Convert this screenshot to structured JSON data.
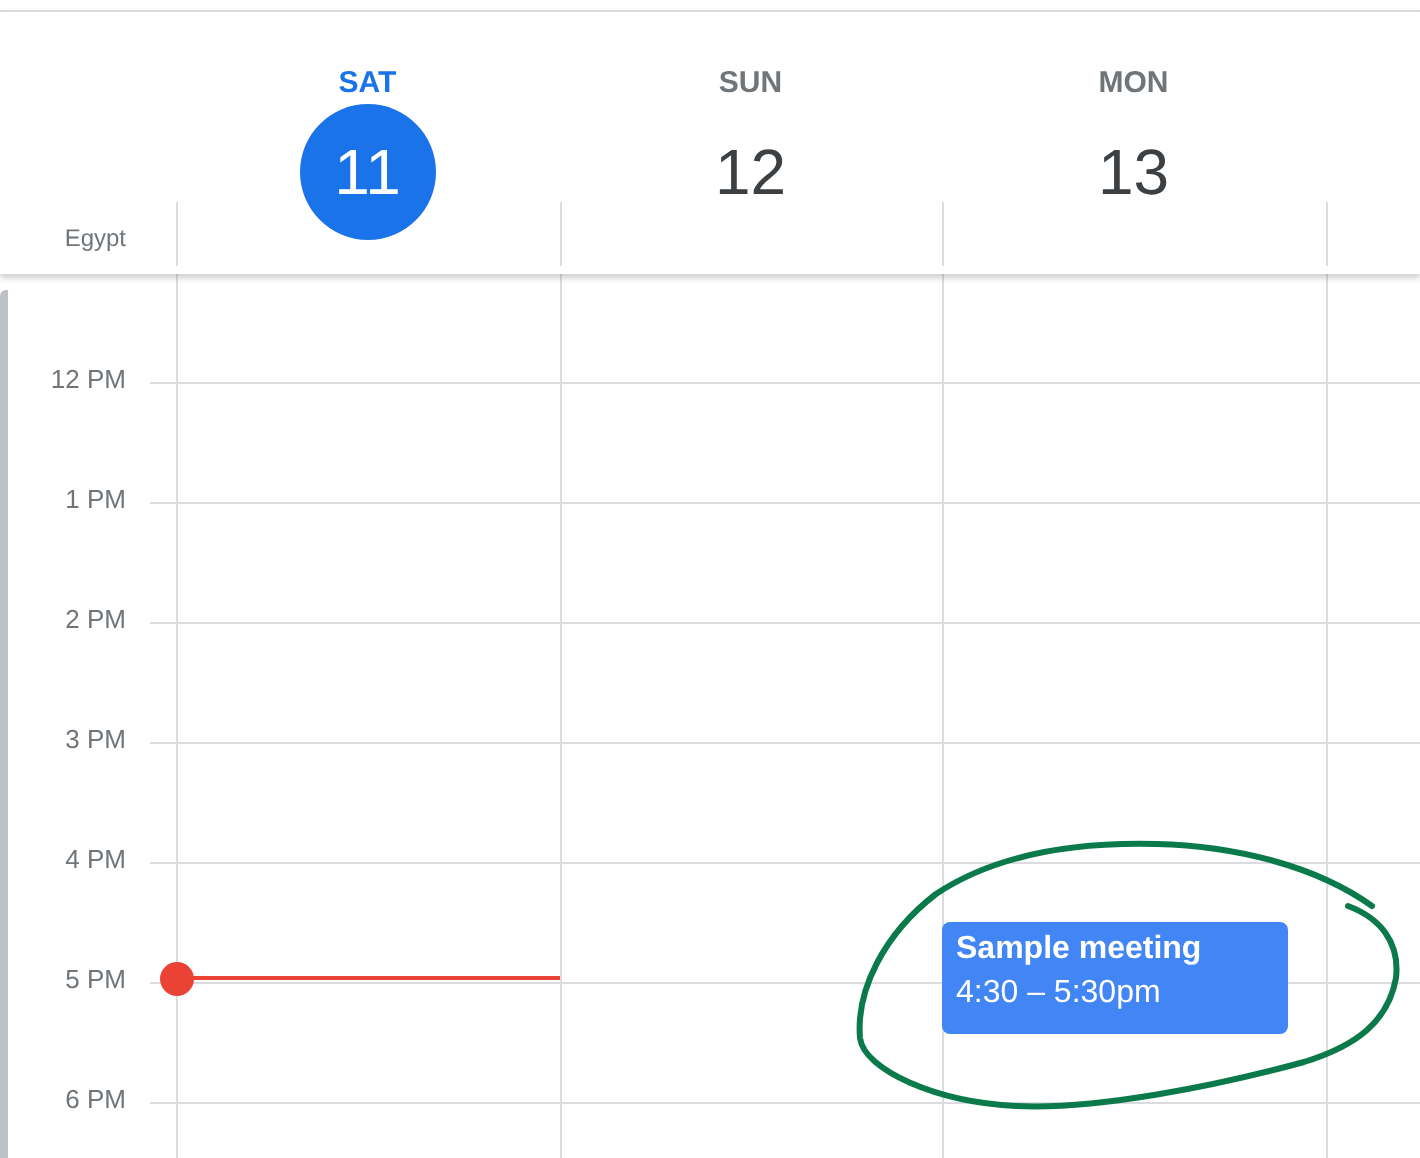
{
  "timezone": "Egypt",
  "days": [
    {
      "name": "SAT",
      "number": "11",
      "selected": true
    },
    {
      "name": "SUN",
      "number": "12",
      "selected": false
    },
    {
      "name": "MON",
      "number": "13",
      "selected": false,
      "events": [
        {
          "title": "Sample meeting",
          "time": "4:30 – 5:30pm",
          "color": "#4285f4"
        }
      ]
    }
  ],
  "hours": [
    "12 PM",
    "1 PM",
    "2 PM",
    "3 PM",
    "4 PM",
    "5 PM",
    "6 PM"
  ]
}
